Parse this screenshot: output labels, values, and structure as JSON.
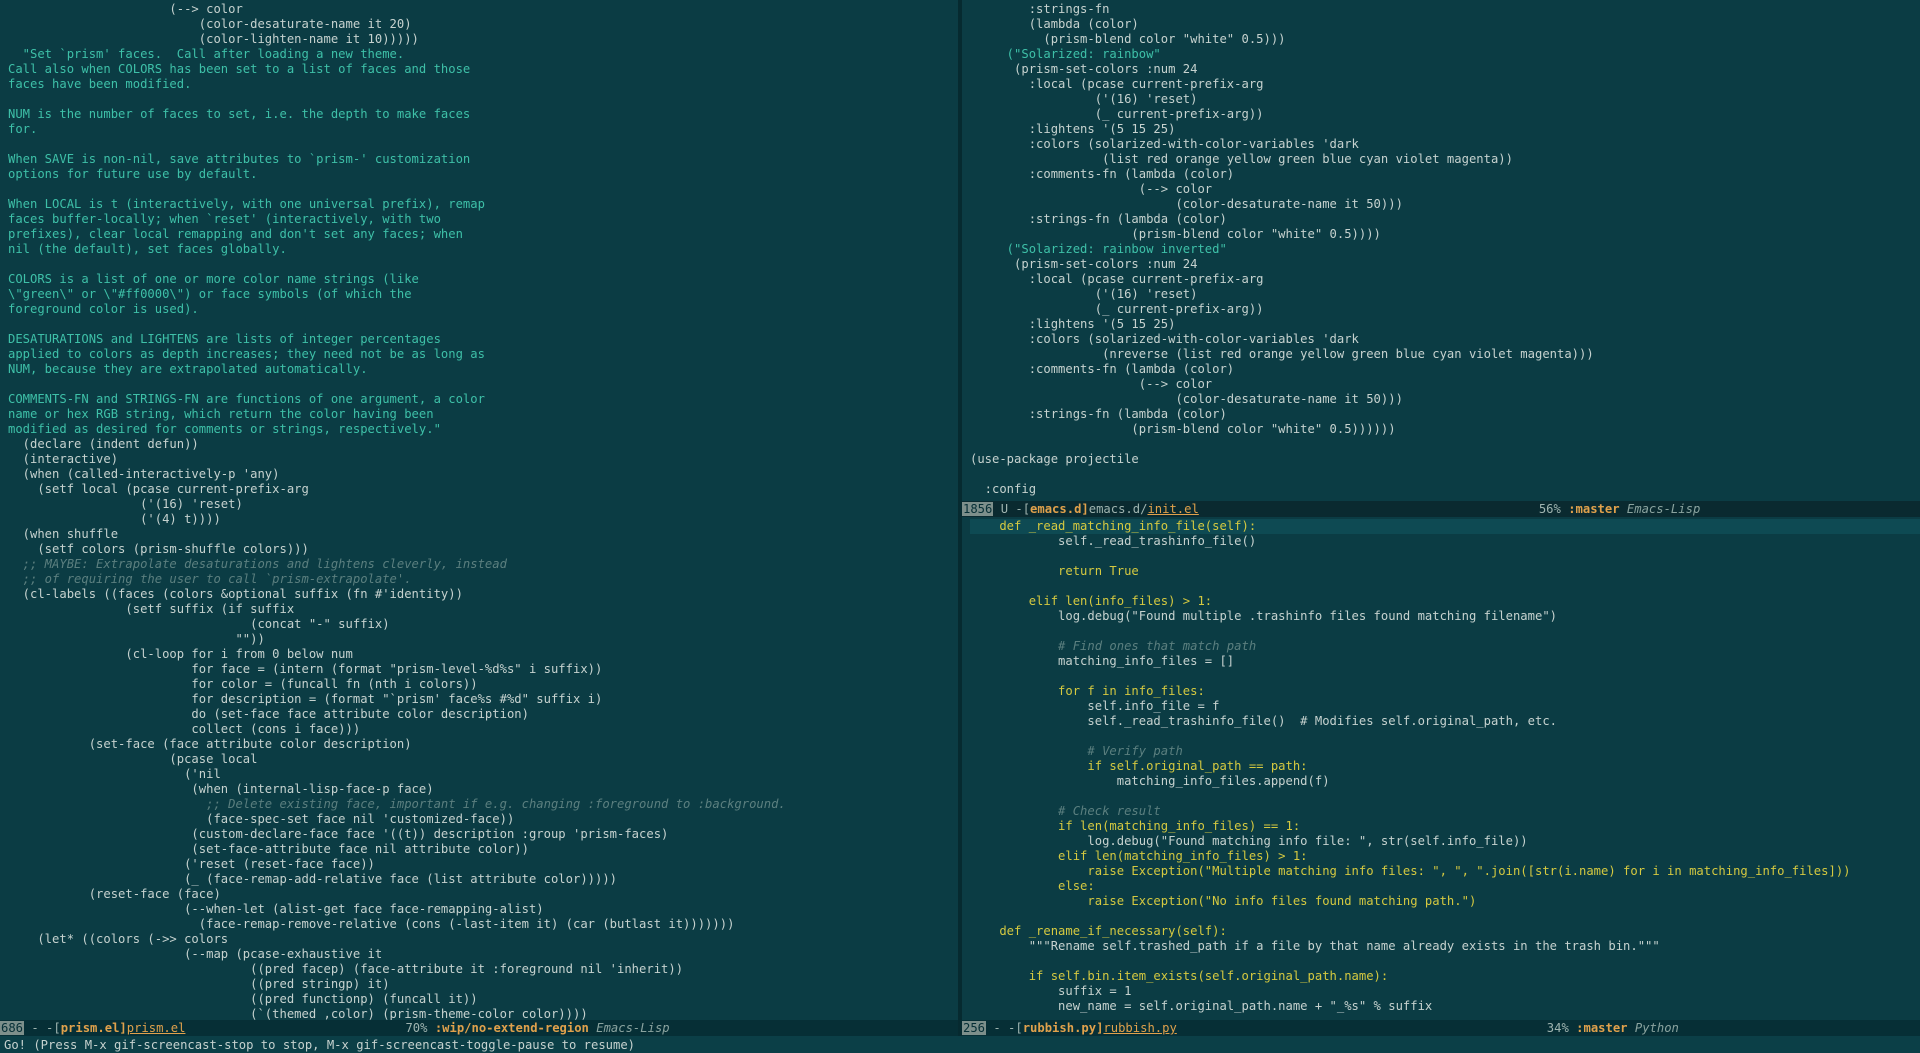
{
  "left_buffer": {
    "lines": [
      "                      (--> color",
      "                          (color-desaturate-name it 20)",
      "                          (color-lighten-name it 10)))))",
      "  \"Set `prism' faces.  Call after loading a new theme.",
      "Call also when COLORS has been set to a list of faces and those",
      "faces have been modified.",
      "",
      "NUM is the number of faces to set, i.e. the depth to make faces",
      "for.",
      "",
      "When SAVE is non-nil, save attributes to `prism-' customization",
      "options for future use by default.",
      "",
      "When LOCAL is t (interactively, with one universal prefix), remap",
      "faces buffer-locally; when `reset' (interactively, with two",
      "prefixes), clear local remapping and don't set any faces; when",
      "nil (the default), set faces globally.",
      "",
      "COLORS is a list of one or more color name strings (like",
      "\\\"green\\\" or \\\"#ff0000\\\") or face symbols (of which the",
      "foreground color is used).",
      "",
      "DESATURATIONS and LIGHTENS are lists of integer percentages",
      "applied to colors as depth increases; they need not be as long as",
      "NUM, because they are extrapolated automatically.",
      "",
      "COMMENTS-FN and STRINGS-FN are functions of one argument, a color",
      "name or hex RGB string, which return the color having been",
      "modified as desired for comments or strings, respectively.\"",
      "  (declare (indent defun))",
      "  (interactive)",
      "  (when (called-interactively-p 'any)",
      "    (setf local (pcase current-prefix-arg",
      "                  ('(16) 'reset)",
      "                  ('(4) t))))",
      "  (when shuffle",
      "    (setf colors (prism-shuffle colors)))",
      "  ;; MAYBE: Extrapolate desaturations and lightens cleverly, instead",
      "  ;; of requiring the user to call `prism-extrapolate'.",
      "  (cl-labels ((faces (colors &optional suffix (fn #'identity))",
      "                (setf suffix (if suffix",
      "                                 (concat \"-\" suffix)",
      "                               \"\"))",
      "                (cl-loop for i from 0 below num",
      "                         for face = (intern (format \"prism-level-%d%s\" i suffix))",
      "                         for color = (funcall fn (nth i colors))",
      "                         for description = (format \"`prism' face%s #%d\" suffix i)",
      "                         do (set-face face attribute color description)",
      "                         collect (cons i face)))",
      "           (set-face (face attribute color description)",
      "                      (pcase local",
      "                        ('nil",
      "                         (when (internal-lisp-face-p face)",
      "                           ;; Delete existing face, important if e.g. changing :foreground to :background.",
      "                           (face-spec-set face nil 'customized-face))",
      "                         (custom-declare-face face '((t)) description :group 'prism-faces)",
      "                         (set-face-attribute face nil attribute color))",
      "                        ('reset (reset-face face))",
      "                        (_ (face-remap-add-relative face (list attribute color)))))",
      "           (reset-face (face)",
      "                        (--when-let (alist-get face face-remapping-alist)",
      "                          (face-remap-remove-relative (cons (-last-item it) (car (butlast it)))))))",
      "    (let* ((colors (->> colors",
      "                        (--map (pcase-exhaustive it",
      "                                 ((pred facep) (face-attribute it :foreground nil 'inherit))",
      "                                 ((pred stringp) it)",
      "                                 ((pred functionp) (funcall it))",
      "                                 (`(themed ,color) (prism-theme-color color))))"
    ]
  },
  "right_top_buffer": {
    "lines": [
      "        :strings-fn",
      "        (lambda (color)",
      "          (prism-blend color \"white\" 0.5)))",
      "     (\"Solarized: rainbow\"",
      "      (prism-set-colors :num 24",
      "        :local (pcase current-prefix-arg",
      "                 ('(16) 'reset)",
      "                 (_ current-prefix-arg))",
      "        :lightens '(5 15 25)",
      "        :colors (solarized-with-color-variables 'dark",
      "                  (list red orange yellow green blue cyan violet magenta))",
      "        :comments-fn (lambda (color)",
      "                       (--> color",
      "                            (color-desaturate-name it 50)))",
      "        :strings-fn (lambda (color)",
      "                      (prism-blend color \"white\" 0.5))))",
      "     (\"Solarized: rainbow inverted\"",
      "      (prism-set-colors :num 24",
      "        :local (pcase current-prefix-arg",
      "                 ('(16) 'reset)",
      "                 (_ current-prefix-arg))",
      "        :lightens '(5 15 25)",
      "        :colors (solarized-with-color-variables 'dark",
      "                  (nreverse (list red orange yellow green blue cyan violet magenta)))",
      "        :comments-fn (lambda (color)",
      "                       (--> color",
      "                            (color-desaturate-name it 50)))",
      "        :strings-fn (lambda (color)",
      "                      (prism-blend color \"white\" 0.5))))))",
      "",
      "(use-package projectile",
      "",
      "  :config"
    ]
  },
  "right_bottom_buffer": {
    "lines": [
      "    def _read_matching_info_file(self):",
      "            self._read_trashinfo_file()",
      "",
      "            return True",
      "",
      "        elif len(info_files) > 1:",
      "            log.debug(\"Found multiple .trashinfo files found matching filename\")",
      "",
      "            # Find ones that match path",
      "            matching_info_files = []",
      "",
      "            for f in info_files:",
      "                self.info_file = f",
      "                self._read_trashinfo_file()  # Modifies self.original_path, etc.",
      "",
      "                # Verify path",
      "                if self.original_path == path:",
      "                    matching_info_files.append(f)",
      "",
      "            # Check result",
      "            if len(matching_info_files) == 1:",
      "                log.debug(\"Found matching info file: \", str(self.info_file))",
      "            elif len(matching_info_files) > 1:",
      "                raise Exception(\"Multiple matching info files: \", \", \".join([str(i.name) for i in matching_info_files]))",
      "            else:",
      "                raise Exception(\"No info files found matching path.\")",
      "",
      "    def _rename_if_necessary(self):",
      "        \"\"\"Rename self.trashed_path if a file by that name already exists in the trash bin.\"\"\"",
      "",
      "        if self.bin.item_exists(self.original_path.name):",
      "            suffix = 1",
      "            new_name = self.original_path.name + \"_%s\" % suffix"
    ]
  },
  "modeline_right_top": {
    "num": "1856",
    "flags": " U -[",
    "buffer": "emacs.d]",
    "path": "emacs.d/",
    "file": "init.el",
    "percent": "56%",
    "branch": ":master",
    "mode": "Emacs-Lisp"
  },
  "modeline_left": {
    "num": "686",
    "flags": " - -[",
    "buffer": "prism.el]",
    "file": "prism.el",
    "percent": "70%",
    "branch": ":wip/no-extend-region",
    "mode": "Emacs-Lisp"
  },
  "modeline_right_bottom": {
    "num": "256",
    "flags": " - -[",
    "buffer": "rubbish.py]",
    "file": "rubbish.py",
    "percent": "34%",
    "branch": ":master",
    "mode": "Python"
  },
  "echo_area": "Go! (Press M-x gif-screencast-stop to stop, M-x gif-screencast-toggle-pause to resume)",
  "colors": {
    "background": "#0b3c44",
    "modeline_bg": "#062f36",
    "accent": "#e0a14c"
  }
}
